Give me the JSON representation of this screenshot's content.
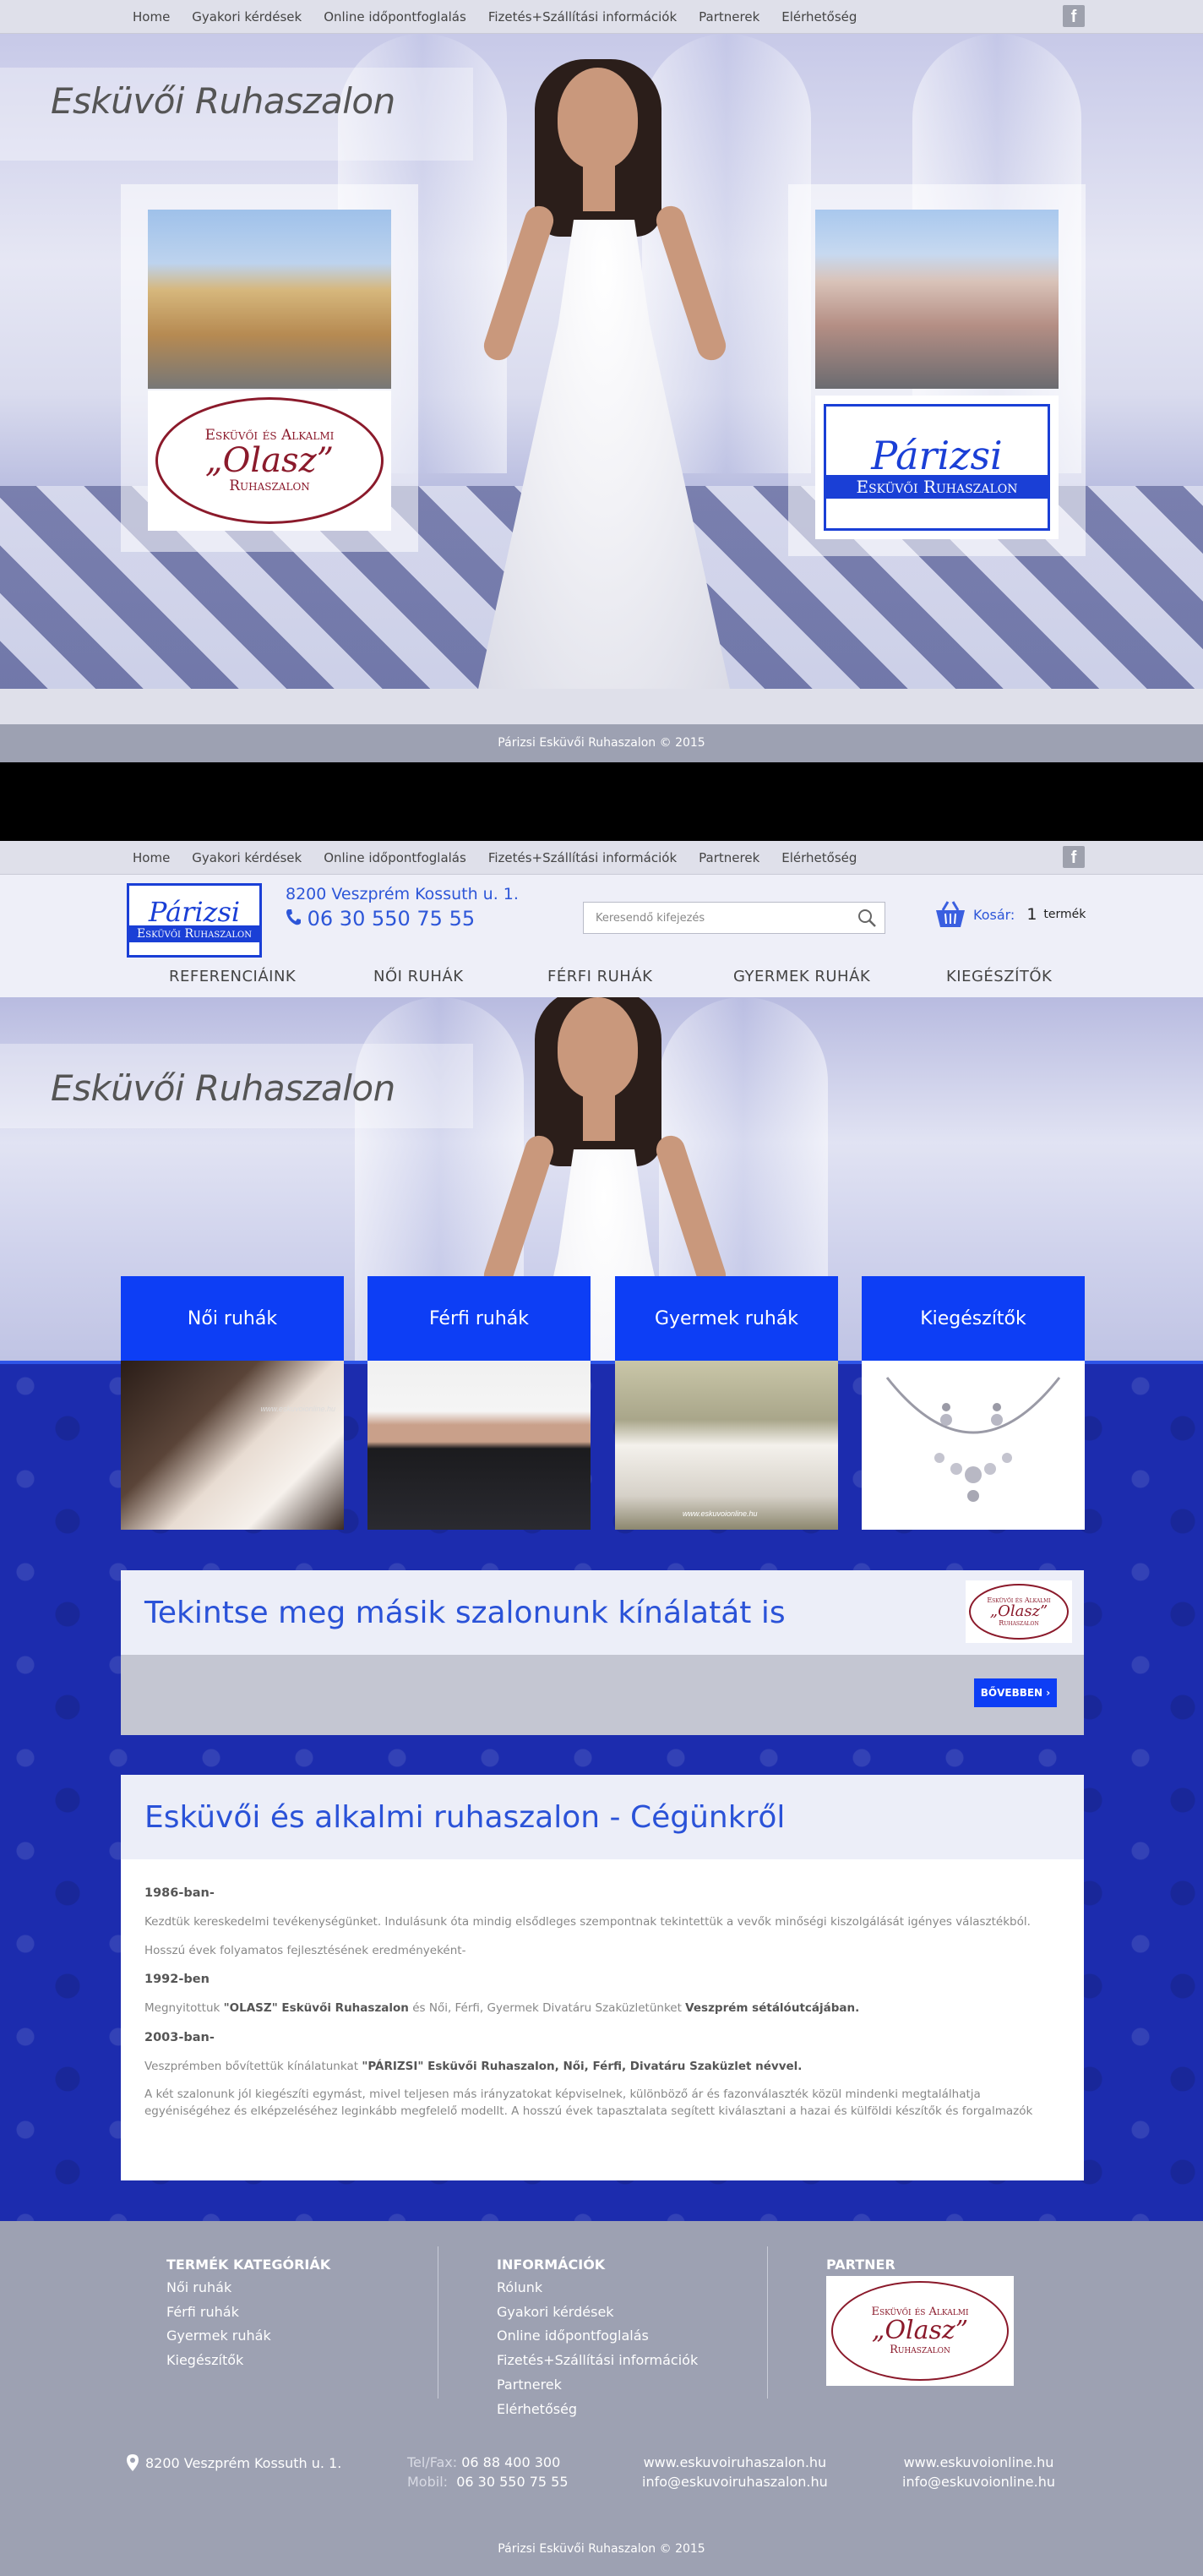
{
  "topnav": {
    "links": [
      "Home",
      "Gyakori kérdések",
      "Online időpontfoglalás",
      "Fizetés+Szállítási információk",
      "Partnerek",
      "Elérhetőség"
    ],
    "facebook": "f"
  },
  "hero": {
    "title": "Esküvői Ruhaszalon"
  },
  "logos": {
    "olasz": {
      "line1": "Esküvői és Alkalmi",
      "line2": "„Olasz”",
      "line3": "Ruhaszalon"
    },
    "parizsi": {
      "line1": "Párizsi",
      "line2": "Esküvői Ruhaszalon"
    }
  },
  "footer_copy": "Párizsi Esküvői Ruhaszalon © 2015",
  "header": {
    "address": "8200 Veszprém Kossuth u. 1.",
    "phone": "06 30 550 75 55",
    "search_placeholder": "Keresendő kifejezés",
    "cart_label": "Kosár:",
    "cart_count": "1",
    "cart_unit": "termék"
  },
  "mainnav": [
    "REFERENCIÁINK",
    "NŐI RUHÁK",
    "FÉRFI RUHÁK",
    "GYERMEK RUHÁK",
    "KIEGÉSZÍTŐK"
  ],
  "categories": [
    "Női ruhák",
    "Férfi ruhák",
    "Gyermek ruhák",
    "Kiegészítők"
  ],
  "watermark": "www.eskuvoionline.hu",
  "promo": {
    "title": "Tekintse meg másik szalonunk kínálatát is",
    "button": "BŐVEBBEN"
  },
  "about": {
    "title": "Esküvői és alkalmi ruhaszalon - Cégünkről",
    "year1": "1986-ban-",
    "p1": "Kezdtük kereskedelmi tevékenységünket. Indulásunk óta mindig elsődleges szempontnak tekintettük a vevők minőségi kiszolgálását igényes választékból.",
    "p2": "Hosszú évek folyamatos fejlesztésének eredményeként-",
    "year2": "1992-ben",
    "p3_a": "Megnyitottuk ",
    "p3_b": "\"OLASZ\" Esküvői Ruhaszalon",
    "p3_c": " és Női, Férfi, Gyermek Divatáru Szaküzletünket ",
    "p3_d": "Veszprém sétálóutcájában.",
    "year3": "2003-ban-",
    "p4_a": "Veszprémben bővítettük kínálatunkat ",
    "p4_b": "\"PÁRIZSI\" Esküvői Ruhaszalon, Női, Férfi, Divatáru Szaküzlet névvel.",
    "p5": "A két szalonunk jól kiegészíti egymást, mivel teljesen más irányzatokat képviselnek, különböző ár és fazonválaszték közül mindenki megtalálhatja egyéniségéhez és elképzeléséhez leginkább megfelelő modellt. A hosszú évek tapasztalata segített kiválasztani a hazai és külföldi készítők és forgalmazók"
  },
  "footer": {
    "col1_title": "TERMÉK KATEGÓRIÁK",
    "col1_items": [
      "Női ruhák",
      "Férfi ruhák",
      "Gyermek ruhák",
      "Kiegészítők"
    ],
    "col2_title": "INFORMÁCIÓK",
    "col2_items": [
      "Rólunk",
      "Gyakori kérdések",
      "Online időpontfoglalás",
      "Fizetés+Szállítási információk",
      "Partnerek",
      "Elérhetőség"
    ],
    "col3_title": "PARTNER",
    "address": "8200 Veszprém Kossuth u. 1.",
    "tel_label": "Tel/Fax:",
    "tel": "06 88 400 300",
    "mobil_label": "Mobil:",
    "mobil": "06 30 550 75 55",
    "site1": "www.eskuvoiruhaszalon.hu",
    "mail1": "info@eskuvoiruhaszalon.hu",
    "site2": "www.eskuvoionline.hu",
    "mail2": "info@eskuvoionline.hu",
    "copyright": "Párizsi Esküvői Ruhaszalon © 2015"
  },
  "colors": {
    "accent": "#0d3ef5",
    "text_blue": "#2a52d8",
    "footer": "#9da1b2",
    "nav": "#dfe0ea"
  }
}
